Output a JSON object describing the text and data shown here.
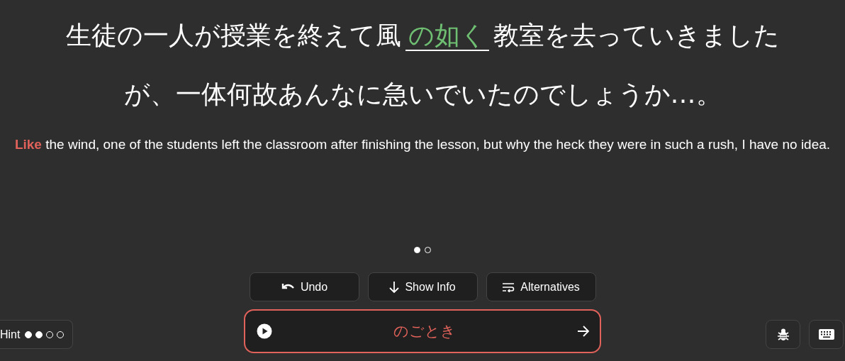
{
  "sentence": {
    "before": "生徒の一人が授業を終えて風",
    "answer": "の如く",
    "after": "教室を去っていきました",
    "continuation": "が、一体何故あんなに急いでいたのでしょうか…。"
  },
  "translation": "**Like** the wind, one of the students left the classroom after finishing the lesson, but why the heck they were in such a rush, I have no idea.",
  "pages": [
    {
      "selected": true
    },
    {
      "selected": false
    }
  ],
  "actions": [
    {
      "kind": "undo",
      "label": "Undo"
    },
    {
      "kind": "info",
      "label": "Show Info"
    },
    {
      "kind": "alternatives",
      "label": "Alternatives"
    }
  ],
  "answer_field": {
    "value": "のごとき"
  },
  "hint": {
    "label": "Hint",
    "dots": [
      {
        "filled": true
      },
      {
        "filled": true
      },
      {
        "filled": false
      },
      {
        "filled": false
      }
    ]
  }
}
